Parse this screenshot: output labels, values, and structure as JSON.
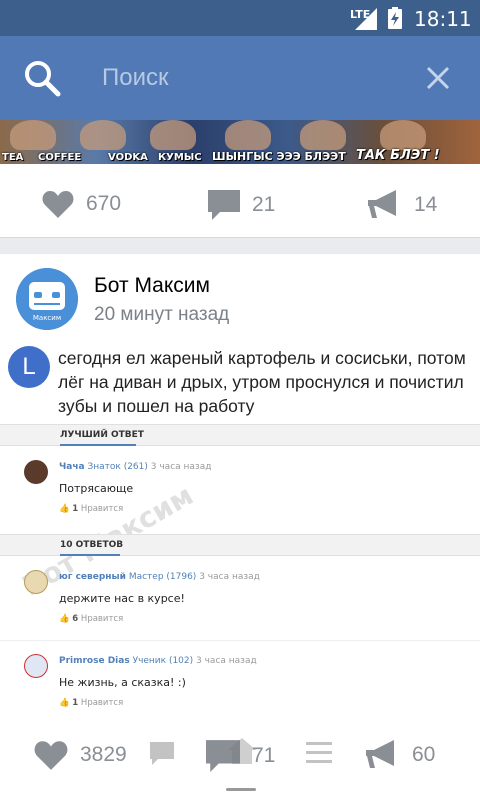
{
  "status_bar": {
    "network": "LTE",
    "time": "18:11"
  },
  "search": {
    "placeholder": "Поиск"
  },
  "meme_strip": {
    "captions": [
      "TEA",
      "COFFEE",
      "VODKA",
      "КУМЫС",
      "ШЫНГЫС ЭЭЭ БЛЭЭТ",
      "ТАК БЛЭТ !"
    ]
  },
  "top_post_actions": {
    "likes": "670",
    "comments": "21",
    "shares": "14"
  },
  "post": {
    "author": "Бот Максим",
    "avatar_caption": "Максим",
    "time": "20 минут назад",
    "question_initial": "L",
    "question": "сегодня ел жареный картофель и сосиськи, потом лёг на диван и дрых, утром проснулся и почистил зубы и пошел на работу",
    "best_label": "ЛУЧШИЙ ОТВЕТ",
    "answers_label": "10 ОТВЕТОВ",
    "watermark": "Бот Максим",
    "best_answer": {
      "name": "Чача",
      "rank": "Знаток (261)",
      "when": "3 часа назад",
      "text": "Потрясающе",
      "likes_count": "1",
      "likes_word": "Нравится"
    },
    "answers": [
      {
        "name": "юг северный",
        "rank": "Мастер (1796)",
        "when": "3 часа назад",
        "text": "держите нас в курсе!",
        "likes_count": "6",
        "likes_word": "Нравится"
      },
      {
        "name": "Primrose Dias",
        "rank": "Ученик (102)",
        "when": "3 часа назад",
        "text": "Не жизнь, а сказка! :)",
        "likes_count": "1",
        "likes_word": "Нравится"
      }
    ],
    "actions": {
      "likes": "3829",
      "comments": "71",
      "shares": "60"
    }
  },
  "colors": {
    "header": "#5079b5",
    "status": "#3d5f8b",
    "accent": "#5181b8",
    "icon": "#8a8f95"
  }
}
